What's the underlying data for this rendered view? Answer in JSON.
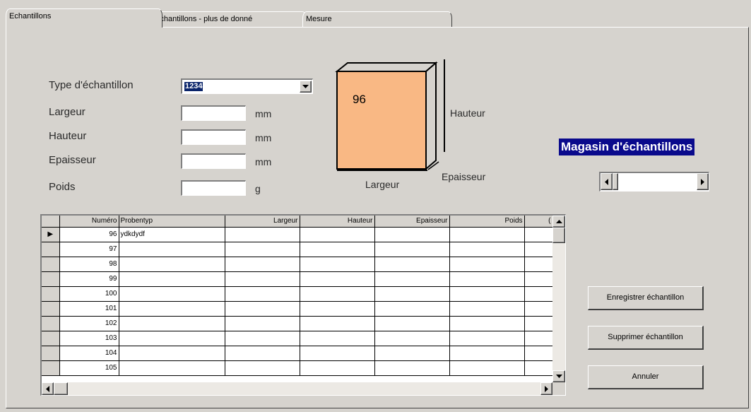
{
  "tabs": [
    {
      "label": "Echantillons",
      "active": true
    },
    {
      "label": "Echantillons - plus de donné",
      "active": false
    },
    {
      "label": "Mesure",
      "active": false
    }
  ],
  "form": {
    "type_label": "Type d'échantillon",
    "type_value": "1234",
    "largeur_label": "Largeur",
    "hauteur_label": "Hauteur",
    "epaisseur_label": "Epaisseur",
    "poids_label": "Poids",
    "unit_mm": "mm",
    "unit_g": "g",
    "largeur_value": "",
    "hauteur_value": "",
    "epaisseur_value": "",
    "poids_value": ""
  },
  "diagram": {
    "number": "96",
    "hauteur": "Hauteur",
    "largeur": "Largeur",
    "epaisseur": "Epaisseur",
    "face_color": "#f9b884"
  },
  "magasin": {
    "title": "Magasin d'échantillons",
    "title_bg": "#0a0a8c"
  },
  "grid": {
    "columns": [
      "Numéro",
      "Probentyp",
      "Largeur",
      "Hauteur",
      "Epaisseur",
      "Poids",
      "("
    ],
    "rows": [
      {
        "numero": "96",
        "probentyp": "ydkdydf"
      },
      {
        "numero": "97",
        "probentyp": ""
      },
      {
        "numero": "98",
        "probentyp": ""
      },
      {
        "numero": "99",
        "probentyp": ""
      },
      {
        "numero": "100",
        "probentyp": ""
      },
      {
        "numero": "101",
        "probentyp": ""
      },
      {
        "numero": "102",
        "probentyp": ""
      },
      {
        "numero": "103",
        "probentyp": ""
      },
      {
        "numero": "104",
        "probentyp": ""
      },
      {
        "numero": "105",
        "probentyp": ""
      }
    ]
  },
  "buttons": {
    "save": "Enregistrer échantillon",
    "delete": "Supprimer échantillon",
    "cancel": "Annuler"
  }
}
